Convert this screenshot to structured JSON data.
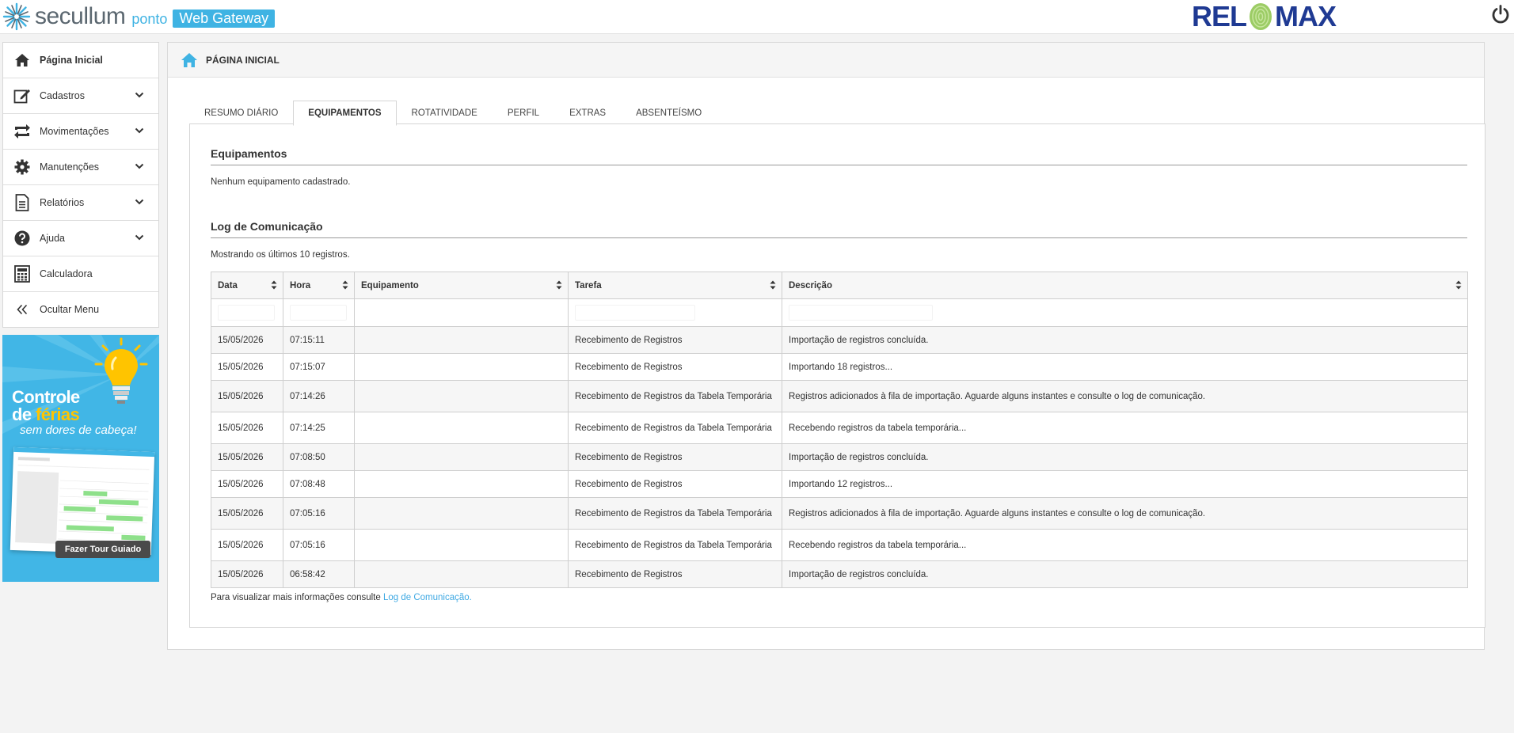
{
  "brand": {
    "name": "secullum",
    "ponto": "ponto",
    "badge": "Web Gateway",
    "partner": "RELOMAX",
    "accent": "#3fb3e3"
  },
  "menu": [
    {
      "label": "Página Inicial",
      "icon": "home-icon",
      "bold": true,
      "expandable": false
    },
    {
      "label": "Cadastros",
      "icon": "edit-icon",
      "expandable": true
    },
    {
      "label": "Movimentações",
      "icon": "swap-icon",
      "expandable": true
    },
    {
      "label": "Manutenções",
      "icon": "gear-icon",
      "expandable": true
    },
    {
      "label": "Relatórios",
      "icon": "document-icon",
      "expandable": true
    },
    {
      "label": "Ajuda",
      "icon": "help-icon",
      "expandable": true
    },
    {
      "label": "Calculadora",
      "icon": "calculator-icon",
      "expandable": false
    },
    {
      "label": "Ocultar Menu",
      "icon": "double-chevron-left-icon",
      "expandable": false
    }
  ],
  "banner": {
    "title_line1": "Controle",
    "title_line2_prefix": "de ",
    "title_line2_highlight": "férias",
    "subtitle": "sem dores de cabeça!",
    "button": "Fazer Tour Guiado"
  },
  "page": {
    "title": "PÁGINA INICIAL",
    "tabs": [
      "RESUMO DIÁRIO",
      "EQUIPAMENTOS",
      "ROTATIVIDADE",
      "PERFIL",
      "EXTRAS",
      "ABSENTEÍSMO"
    ],
    "active_tab": "EQUIPAMENTOS"
  },
  "equipamentos": {
    "title": "Equipamentos",
    "empty_message": "Nenhum equipamento cadastrado."
  },
  "log": {
    "title": "Log de Comunicação",
    "showing": "Mostrando os últimos 10 registros.",
    "columns": [
      "Data",
      "Hora",
      "Equipamento",
      "Tarefa",
      "Descrição"
    ],
    "rows": [
      [
        "15/05/2026",
        "07:15:11",
        "",
        "Recebimento de Registros",
        "Importação de registros concluída."
      ],
      [
        "15/05/2026",
        "07:15:07",
        "",
        "Recebimento de Registros",
        "Importando 18 registros..."
      ],
      [
        "15/05/2026",
        "07:14:26",
        "",
        "Recebimento de Registros da Tabela Temporária",
        "Registros adicionados à fila de importação. Aguarde alguns instantes e consulte o log de comunicação."
      ],
      [
        "15/05/2026",
        "07:14:25",
        "",
        "Recebimento de Registros da Tabela Temporária",
        "Recebendo registros da tabela temporária..."
      ],
      [
        "15/05/2026",
        "07:08:50",
        "",
        "Recebimento de Registros",
        "Importação de registros concluída."
      ],
      [
        "15/05/2026",
        "07:08:48",
        "",
        "Recebimento de Registros",
        "Importando 12 registros..."
      ],
      [
        "15/05/2026",
        "07:05:16",
        "",
        "Recebimento de Registros da Tabela Temporária",
        "Registros adicionados à fila de importação. Aguarde alguns instantes e consulte o log de comunicação."
      ],
      [
        "15/05/2026",
        "07:05:16",
        "",
        "Recebimento de Registros da Tabela Temporária",
        "Recebendo registros da tabela temporária..."
      ],
      [
        "15/05/2026",
        "06:58:42",
        "",
        "Recebimento de Registros",
        "Importação de registros concluída."
      ]
    ],
    "footer_text": "Para visualizar mais informações consulte ",
    "footer_link": "Log de Comunicação."
  }
}
